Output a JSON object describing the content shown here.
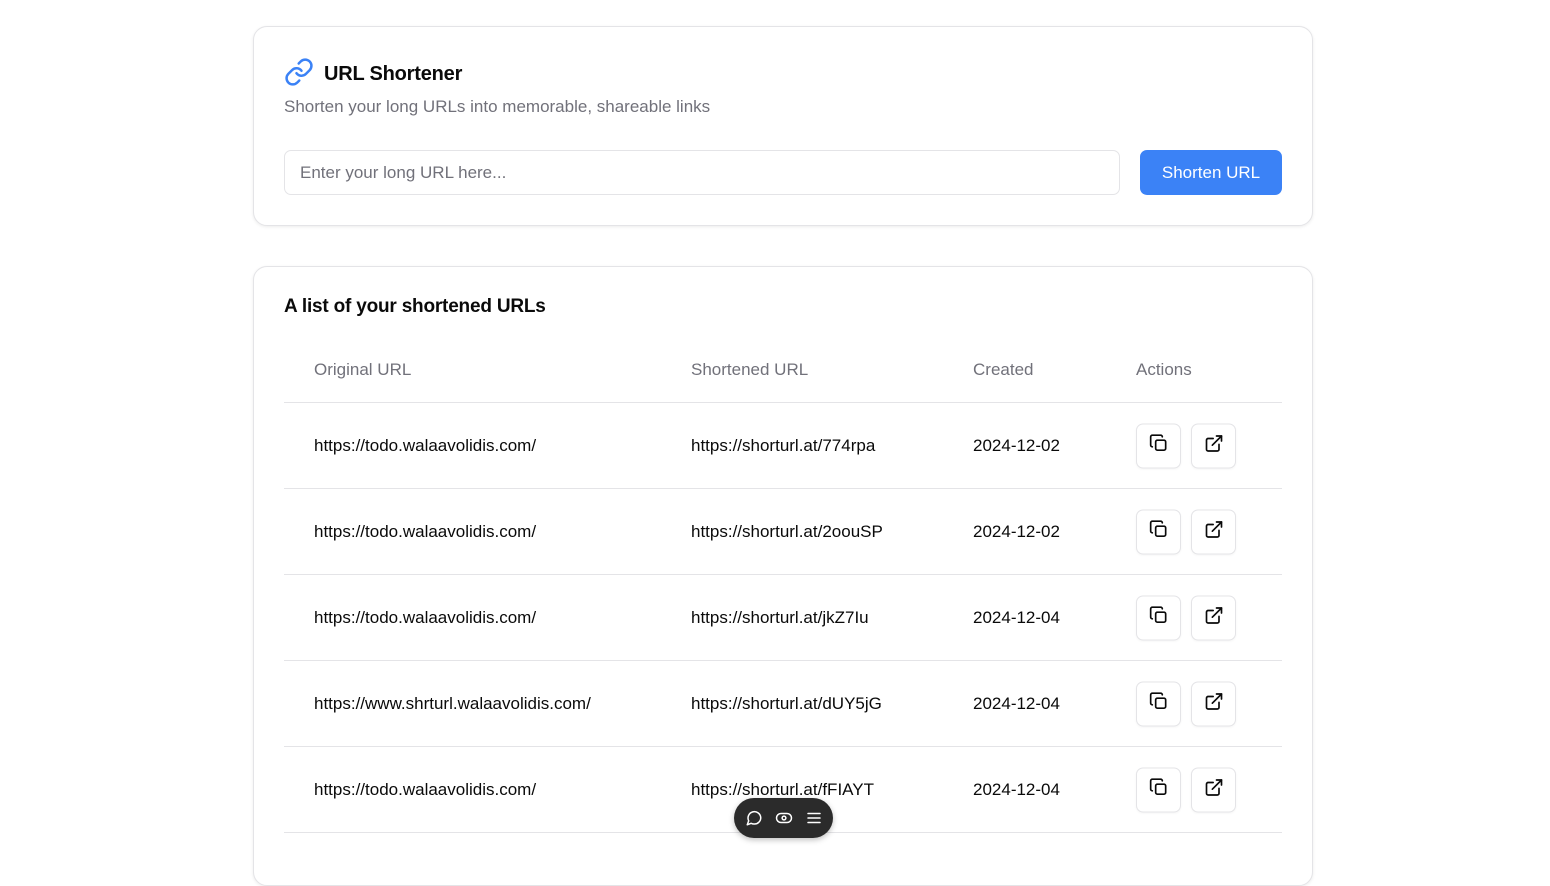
{
  "header": {
    "icon": "link-icon",
    "title": "URL Shortener",
    "subtitle": "Shorten your long URLs into memorable, shareable links",
    "input_placeholder": "Enter your long URL here...",
    "input_value": "",
    "button_label": "Shorten URL",
    "accent_color": "#3b82f6"
  },
  "list": {
    "title": "A list of your shortened URLs",
    "columns": [
      "Original URL",
      "Shortened URL",
      "Created",
      "Actions"
    ],
    "rows": [
      {
        "original": "https://todo.walaavolidis.com/",
        "short": "https://shorturl.at/774rpa",
        "created": "2024-12-02"
      },
      {
        "original": "https://todo.walaavolidis.com/",
        "short": "https://shorturl.at/2oouSP",
        "created": "2024-12-02"
      },
      {
        "original": "https://todo.walaavolidis.com/",
        "short": "https://shorturl.at/jkZ7Iu",
        "created": "2024-12-04"
      },
      {
        "original": "https://www.shrturl.walaavolidis.com/",
        "short": "https://shorturl.at/dUY5jG",
        "created": "2024-12-04"
      },
      {
        "original": "https://todo.walaavolidis.com/",
        "short": "https://shorturl.at/fFIAYT",
        "created": "2024-12-04"
      }
    ],
    "row_actions": [
      "copy-icon",
      "external-link-icon"
    ]
  },
  "toolbar": {
    "icons": [
      "comment-icon",
      "eye-icon",
      "menu-icon"
    ]
  }
}
